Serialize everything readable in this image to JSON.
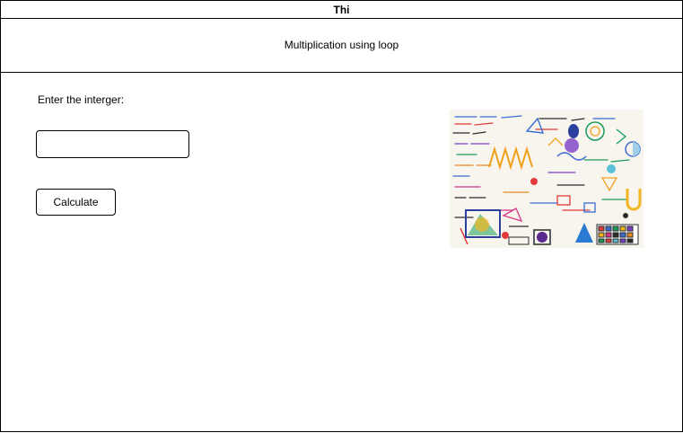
{
  "window": {
    "title": "Thi"
  },
  "header": {
    "title": "Multiplication using loop"
  },
  "form": {
    "input_label": "Enter the interger:",
    "input_value": "",
    "calculate_label": "Calculate"
  },
  "illustration": {
    "icon": "math-doodles-image"
  }
}
